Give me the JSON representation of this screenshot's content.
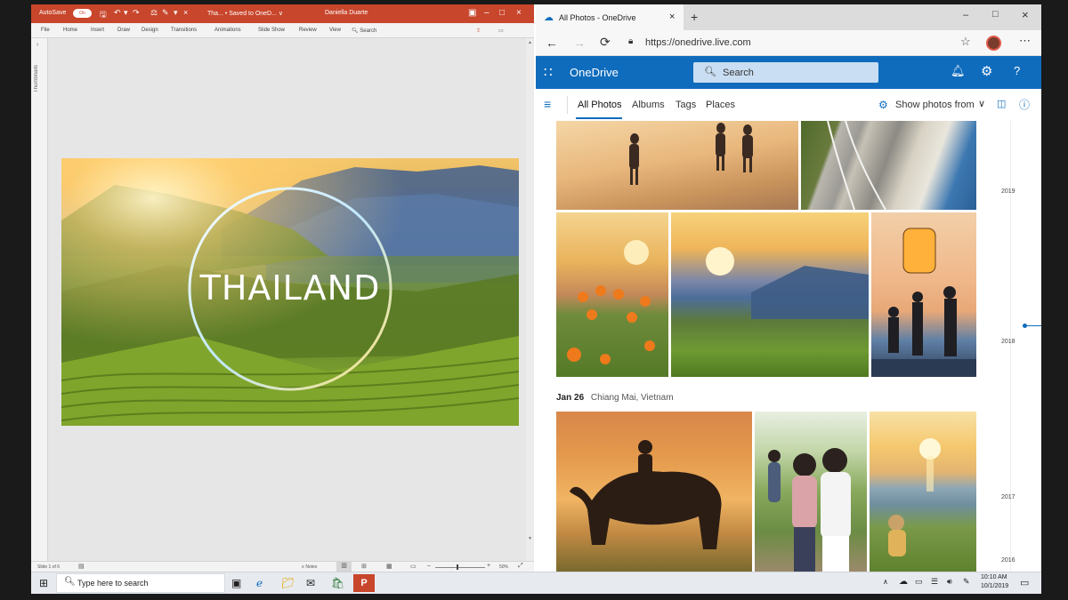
{
  "powerpoint": {
    "autosave_label": "AutoSave",
    "autosave_state": "On",
    "doc_title": "Tha... • Saved to OneD... ∨",
    "user_name": "Daniella Duarte",
    "ribbon_tabs": [
      "File",
      "Home",
      "Insert",
      "Draw",
      "Design",
      "Transitions",
      "Animations",
      "Slide Show",
      "Review",
      "View"
    ],
    "search_label": "Search",
    "thumbnails_label": "Thumbnails",
    "slide_title": "THAILAND",
    "status_slide": "Slide 1 of 6",
    "status_notes": "Notes",
    "zoom": "50%"
  },
  "browser": {
    "tab_title": "All Photos - OneDrive",
    "url": "https://onedrive.live.com"
  },
  "onedrive": {
    "app_name": "OneDrive",
    "search_placeholder": "Search",
    "nav_tabs": [
      "All Photos",
      "Albums",
      "Tags",
      "Places"
    ],
    "active_tab": "All Photos",
    "show_photos_from": "Show photos from",
    "group_date": "Jan 26",
    "group_location": "Chiang Mai, Vietnam",
    "timeline_years": [
      "2019",
      "2018",
      "2017",
      "2016"
    ]
  },
  "taskbar": {
    "search_placeholder": "Type here to search",
    "time": "10:10 AM",
    "date": "10/1/2019"
  },
  "colors": {
    "ppt_accent": "#c8462c",
    "onedrive_accent": "#0f6cbd"
  }
}
